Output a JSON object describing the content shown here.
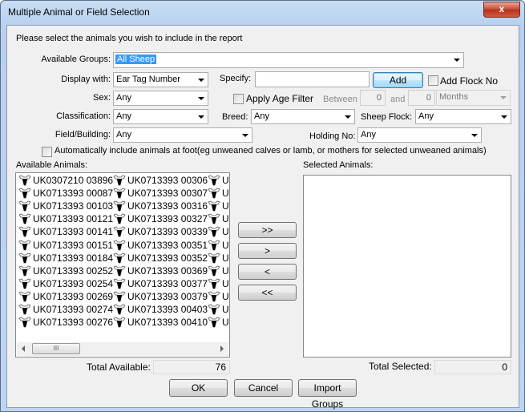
{
  "window": {
    "title": "Multiple Animal or Field Selection",
    "close_label": "x"
  },
  "instructions": "Please select the animals you wish to include in the report",
  "filters": {
    "available_groups": {
      "label": "Available Groups:",
      "value": "All Sheep"
    },
    "display_with": {
      "label": "Display with:",
      "value": "Ear Tag Number"
    },
    "specify": {
      "label": "Specify:",
      "value": "",
      "add_button": "Add"
    },
    "add_flock_no": {
      "label": "Add Flock No",
      "checked": false
    },
    "sex": {
      "label": "Sex:",
      "value": "Any"
    },
    "age_filter": {
      "label": "Apply Age Filter",
      "checked": false,
      "between_label": "Between",
      "from": "0",
      "and_label": "and",
      "to": "0",
      "unit": "Months"
    },
    "classification": {
      "label": "Classification:",
      "value": "Any"
    },
    "breed": {
      "label": "Breed:",
      "value": "Any"
    },
    "sheep_flock": {
      "label": "Sheep Flock:",
      "value": "Any"
    },
    "field_building": {
      "label": "Field/Building:",
      "value": "Any"
    },
    "holding_no": {
      "label": "Holding No:",
      "value": "Any"
    },
    "auto_include": {
      "label": "Automatically include animals at foot(eg unweaned calves or lamb, or mothers for selected unweaned animals)",
      "checked": false
    }
  },
  "available": {
    "label": "Available Animals:",
    "columns": [
      [
        "UK0307210 03896",
        "UK0713393 00087",
        "UK0713393 00103",
        "UK0713393 00121",
        "UK0713393 00141",
        "UK0713393 00151",
        "UK0713393 00184",
        "UK0713393 00252",
        "UK0713393 00254",
        "UK0713393 00269",
        "UK0713393 00274",
        "UK0713393 00276"
      ],
      [
        "UK0713393 00306",
        "UK0713393 00307",
        "UK0713393 00316",
        "UK0713393 00327",
        "UK0713393 00339",
        "UK0713393 00351",
        "UK0713393 00352",
        "UK0713393 00369",
        "UK0713393 00377",
        "UK0713393 00379",
        "UK0713393 00403",
        "UK0713393 00410"
      ],
      [
        "U",
        "U",
        "U",
        "U",
        "U",
        "U",
        "U",
        "U",
        "U",
        "U",
        "U",
        "U"
      ]
    ],
    "scroll_thumb_glyph": "III",
    "total_label": "Total Available:",
    "total": "76"
  },
  "transfer_buttons": {
    "add_all": ">>",
    "add": ">",
    "remove": "<",
    "remove_all": "<<"
  },
  "selected": {
    "label": "Selected Animals:",
    "items": [],
    "total_label": "Total Selected:",
    "total": "0"
  },
  "footer": {
    "ok": "OK",
    "cancel": "Cancel",
    "import_groups": "Import Groups"
  },
  "colors": {
    "selection_highlight": "#3399ff",
    "default_button_border": "#3c7fb1",
    "close_button": "#c7452f"
  }
}
